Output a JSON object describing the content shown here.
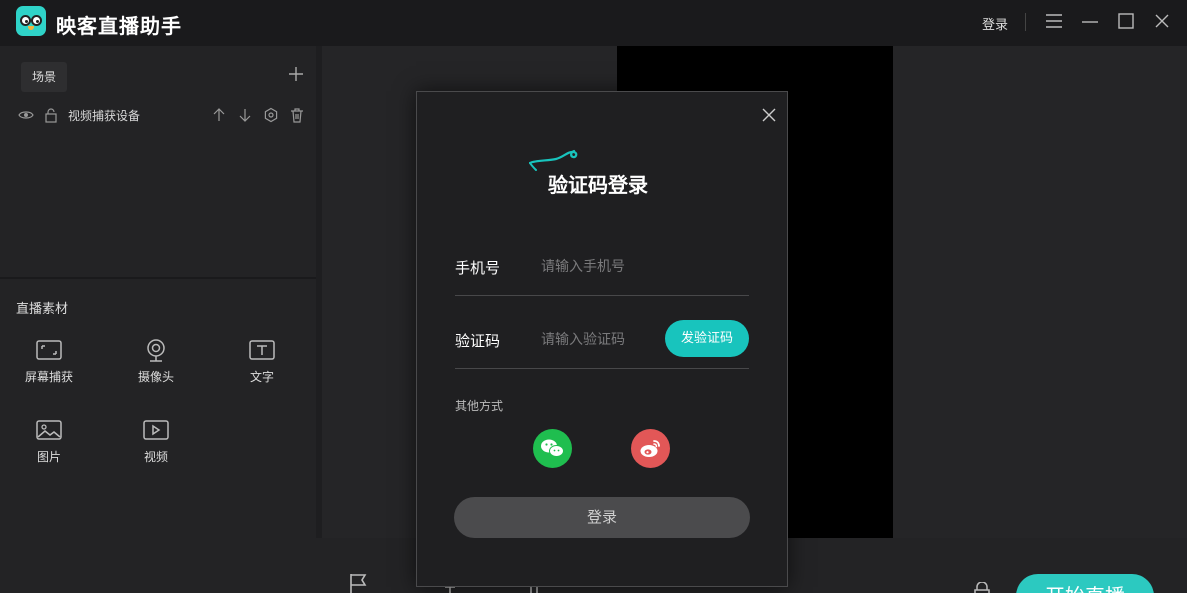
{
  "titlebar": {
    "app_title": "映客直播助手",
    "login_label": "登录",
    "icons": [
      "menu-icon",
      "minimize-icon",
      "maximize-icon",
      "close-icon"
    ]
  },
  "scene_panel": {
    "tab_label": "场景",
    "sources": [
      {
        "label": "视频捕获设备"
      }
    ]
  },
  "materials": {
    "title": "直播素材",
    "items": [
      {
        "label": "屏幕捕获",
        "icon": "screen-capture-icon"
      },
      {
        "label": "摄像头",
        "icon": "camera-icon"
      },
      {
        "label": "文字",
        "icon": "text-icon"
      },
      {
        "label": "图片",
        "icon": "image-icon"
      },
      {
        "label": "视频",
        "icon": "video-icon"
      }
    ]
  },
  "bottombar": {
    "start_label": "开始直播"
  },
  "login_modal": {
    "title": "验证码登录",
    "phone_label": "手机号",
    "phone_placeholder": "请输入手机号",
    "code_label": "验证码",
    "code_placeholder": "请输入验证码",
    "send_code_label": "发验证码",
    "other_methods_label": "其他方式",
    "login_button_label": "登录"
  },
  "colors": {
    "accent": "#18c4bd",
    "wechat": "#1fbe4f",
    "weibo": "#e25757"
  }
}
